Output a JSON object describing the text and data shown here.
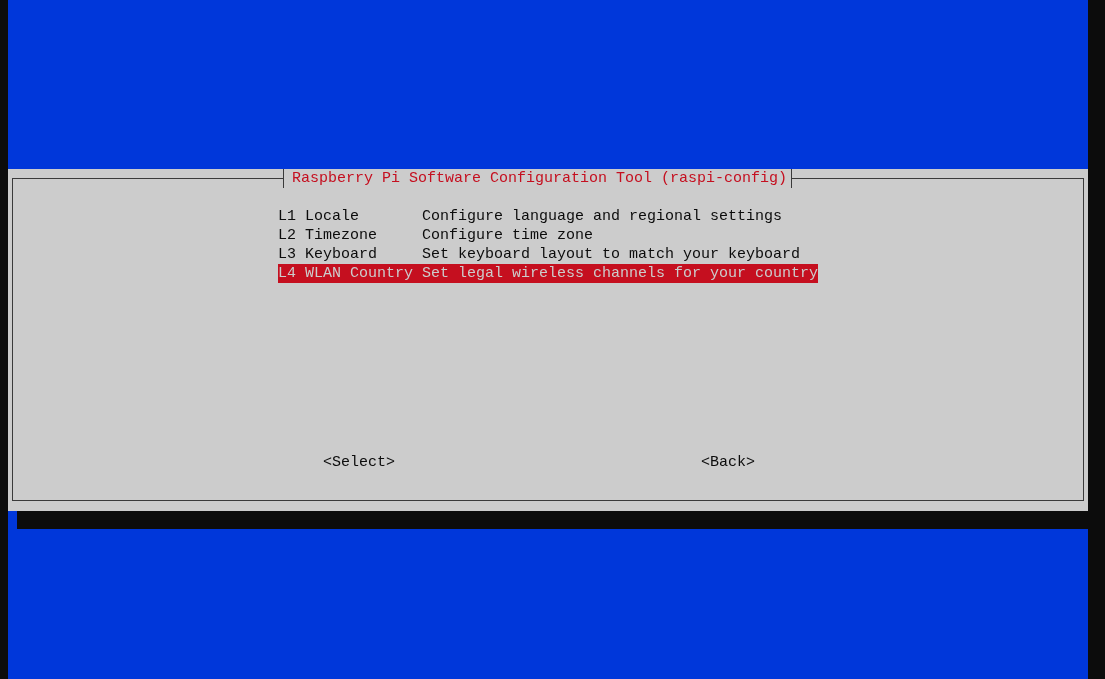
{
  "dialog": {
    "title": "Raspberry Pi Software Configuration Tool (raspi-config)"
  },
  "menu_items": [
    {
      "key": "L1 Locale",
      "description": "Configure language and regional settings",
      "selected": false
    },
    {
      "key": "L2 Timezone",
      "description": "Configure time zone",
      "selected": false
    },
    {
      "key": "L3 Keyboard",
      "description": "Set keyboard layout to match your keyboard",
      "selected": false
    },
    {
      "key": "L4 WLAN Country",
      "description": "Set legal wireless channels for your country",
      "selected": true
    }
  ],
  "buttons": [
    {
      "label": "<Select>"
    },
    {
      "label": "<Back>"
    }
  ]
}
